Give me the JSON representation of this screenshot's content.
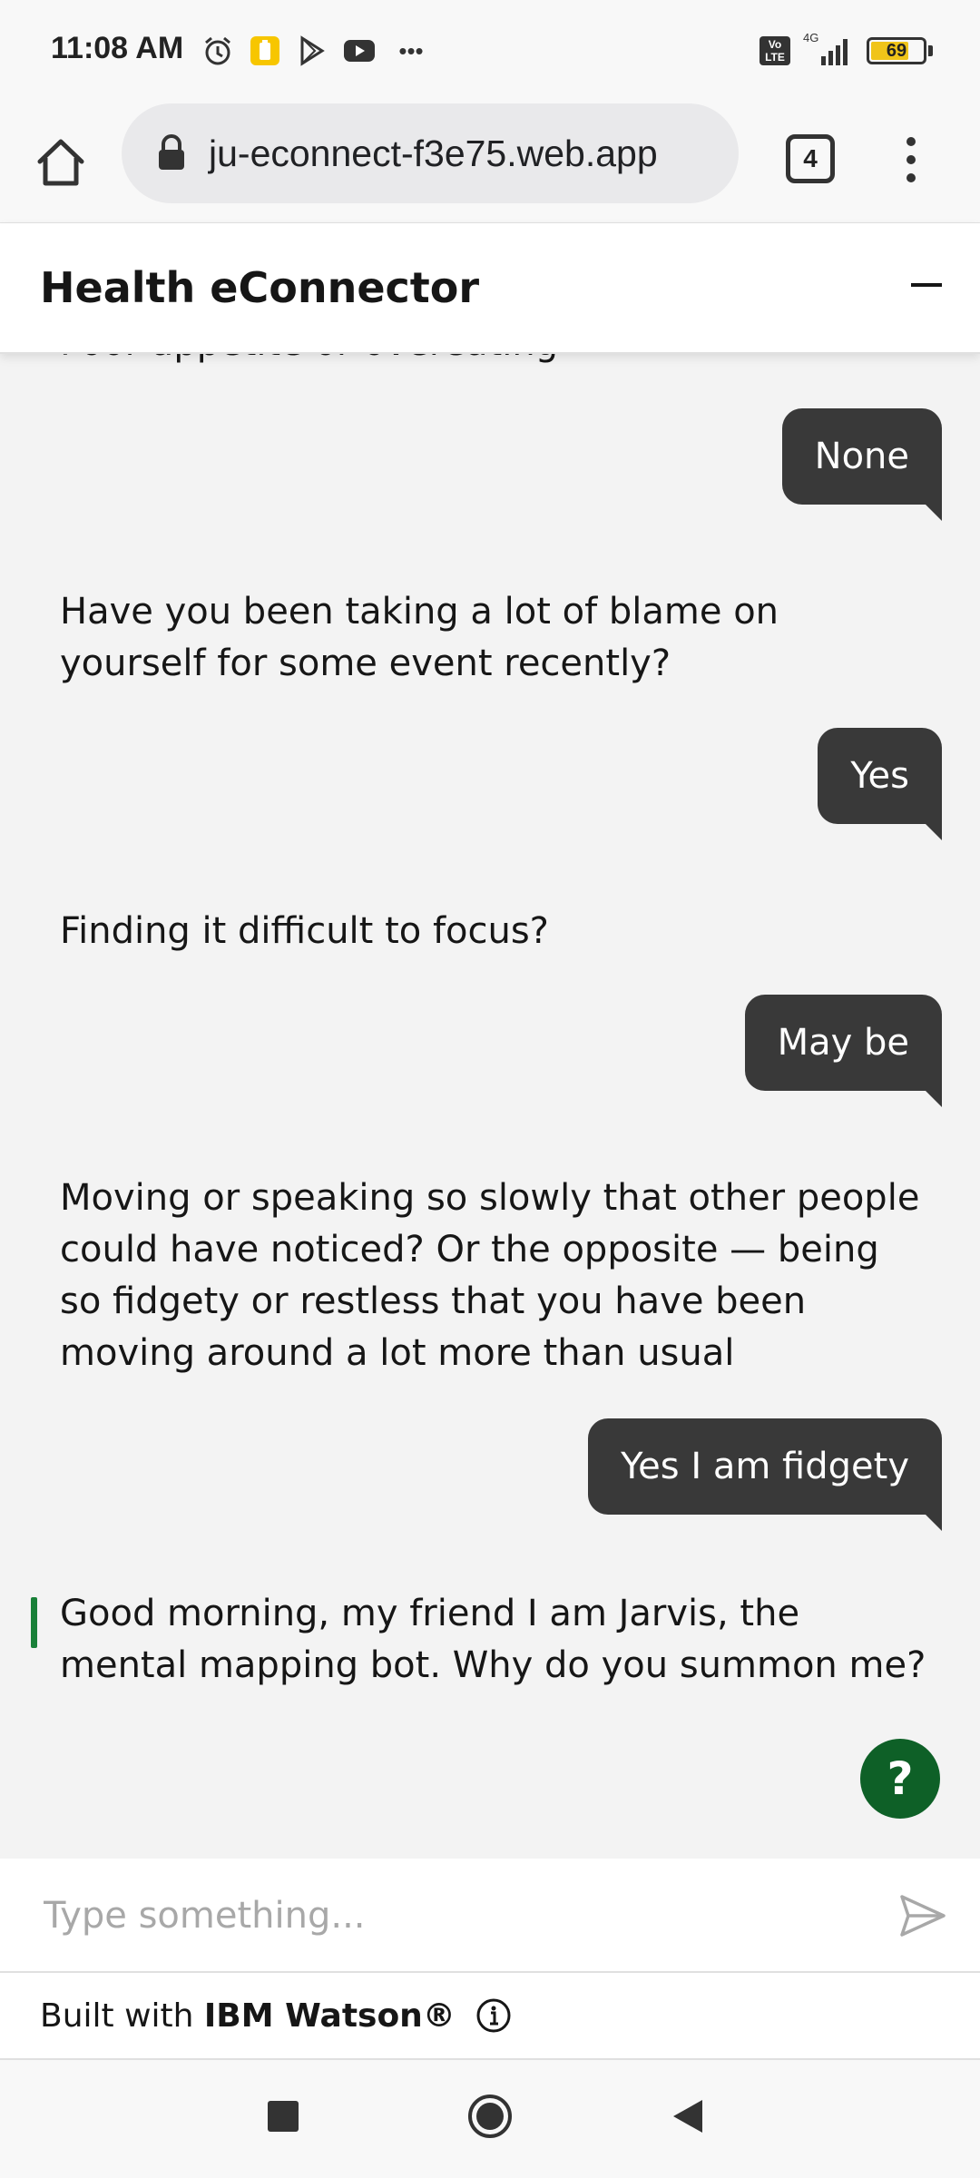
{
  "status_bar": {
    "time": "11:08 AM",
    "more_dots": "•••",
    "network": "4G",
    "volte": "Vo LTE",
    "battery_level": "69"
  },
  "browser": {
    "url": "ju-econnect-f3e75.web.app",
    "tab_count": "4"
  },
  "chat": {
    "title": "Health eConnector",
    "cut_off_message": "Poor appetite or overeating",
    "messages": [
      {
        "from": "user",
        "text": "None"
      },
      {
        "from": "bot",
        "text": "Have you been taking a lot of blame on yourself for some event recently?"
      },
      {
        "from": "user",
        "text": "Yes"
      },
      {
        "from": "bot",
        "text": "Finding it difficult to focus?"
      },
      {
        "from": "user",
        "text": "May be"
      },
      {
        "from": "bot",
        "text": "Moving or speaking so slowly that other people could have noticed? Or the opposite — being so fidgety or restless that you have been moving around a lot more than usual"
      },
      {
        "from": "user",
        "text": "Yes I am fidgety"
      },
      {
        "from": "bot",
        "text": "Good morning, my friend I am Jarvis, the mental mapping bot. Why do you summon me?"
      }
    ],
    "help_label": "?",
    "input_placeholder": "Type something...",
    "input_value": ""
  },
  "footer": {
    "prefix": "Built with ",
    "brand": "IBM Watson®"
  },
  "colors": {
    "user_bubble": "#393939",
    "chat_background": "#f3f3f3",
    "accent_green": "#0e6027",
    "latest_indicator": "#198038"
  }
}
